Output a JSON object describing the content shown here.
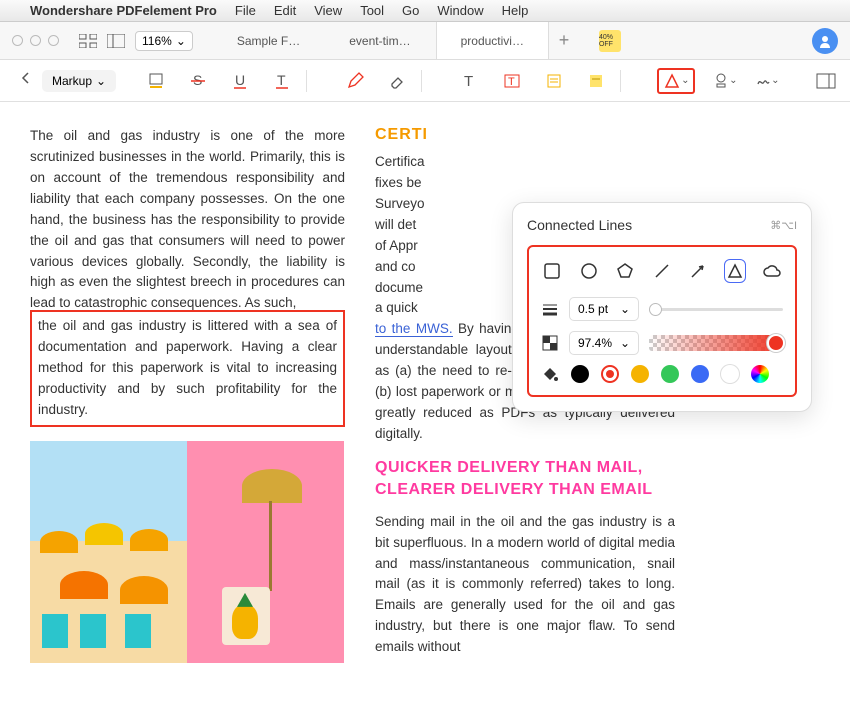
{
  "menubar": {
    "app": "Wondershare PDFelement Pro",
    "items": [
      "File",
      "Edit",
      "View",
      "Tool",
      "Go",
      "Window",
      "Help"
    ]
  },
  "titlebar": {
    "zoom": "116%",
    "tabs": [
      {
        "label": "Sample F…"
      },
      {
        "label": "event-tim…"
      },
      {
        "label": "productivi…",
        "active": true
      }
    ],
    "promo": "40% OFF"
  },
  "toolbar": {
    "markup_label": "Markup"
  },
  "doc": {
    "left_para_a": "The oil and gas industry is one of the more scrutinized businesses in the world. Primarily, this is on account of the tremendous responsibility and liability that each company possesses. On the one hand, the business has the responsibility to provide the oil and gas that consumers will need to power various devices globally. Secondly, the liability is high as even the slightest breech in procedures can lead to catastrophic consequences. As such,",
    "left_para_b": "the oil and gas industry is littered with a sea of documentation and paperwork. Having a clear method for this paperwork is vital to increasing productivity and by such profitability for the industry.",
    "heading_certi": "CERTI",
    "right_para_a_pre": "Certifica",
    "right_para_a_lines": "fixes be\nSurveyo\nwill det\nof Appr\nand co\ndocume\na quick",
    "right_para_link": "to the MWS.",
    "right_para_a_post": " By having the information in a very understandable layout, productivity is increased as (a) the need to re-do tasks is minimized and (b) lost paperwork or misunderstood paperwork is greatly reduced as PDFs as typically delivered digitally.",
    "heading_pink": "QUICKER DELIVERY THAN MAIL, CLEARER DELIVERY THAN EMAIL",
    "right_para_b": "Sending mail in the oil and the gas industry is a bit superfluous. In a modern world of digital media and mass/instantaneous communication, snail mail (as it is commonly referred) takes to long. Emails are generally used for the oil and gas industry, but there is one major flaw. To send emails without"
  },
  "popup": {
    "title": "Connected Lines",
    "shortcut": "⌘⌥I",
    "thickness": "0.5 pt",
    "opacity": "97.4%",
    "colors": [
      "#000000",
      "#e32619",
      "#f5b300",
      "#34c759",
      "#3a6af5",
      "#ffffff"
    ]
  }
}
